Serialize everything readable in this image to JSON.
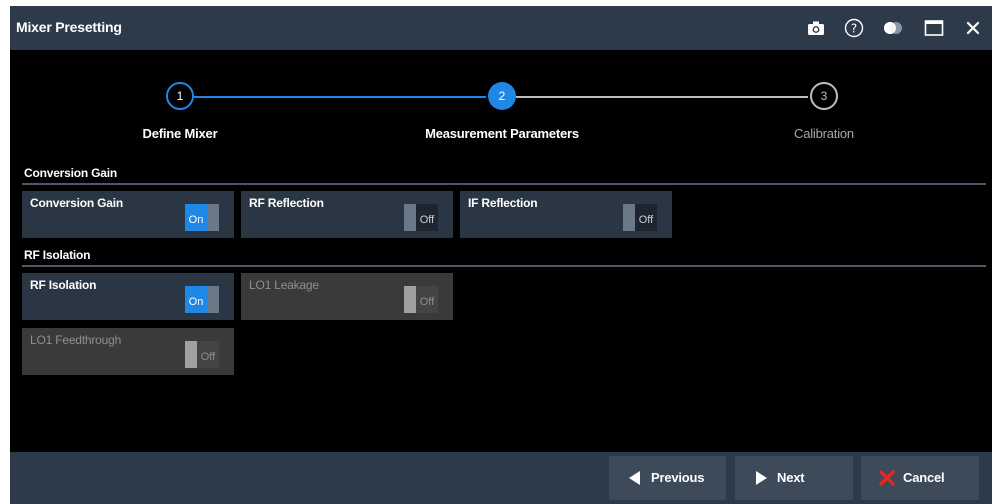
{
  "window": {
    "title": "Mixer Presetting",
    "title_icons": [
      "camera-icon",
      "help-icon",
      "toggle-theme-icon",
      "maximize-icon",
      "close-icon"
    ]
  },
  "stepper": {
    "steps": [
      {
        "number": "1",
        "label": "Define Mixer",
        "state": "done"
      },
      {
        "number": "2",
        "label": "Measurement Parameters",
        "state": "active"
      },
      {
        "number": "3",
        "label": "Calibration",
        "state": "pending"
      }
    ]
  },
  "sections": {
    "conversion_gain": {
      "header": "Conversion Gain",
      "tiles": [
        {
          "label": "Conversion Gain",
          "state": "On",
          "enabled": true
        },
        {
          "label": "RF Reflection",
          "state": "Off",
          "enabled": true
        },
        {
          "label": "IF Reflection",
          "state": "Off",
          "enabled": true
        }
      ]
    },
    "rf_isolation": {
      "header": "RF Isolation",
      "tiles": [
        {
          "label": "RF Isolation",
          "state": "On",
          "enabled": true
        },
        {
          "label": "LO1 Leakage",
          "state": "Off",
          "enabled": false
        },
        {
          "label": "LO1 Feedthrough",
          "state": "Off",
          "enabled": false
        }
      ]
    }
  },
  "footer": {
    "previous": "Previous",
    "next": "Next",
    "cancel": "Cancel"
  },
  "colors": {
    "accent": "#1f88e6",
    "titlebar": "#2d3a4a",
    "tile": "#2a3644",
    "cancel_icon": "#e8261c"
  }
}
